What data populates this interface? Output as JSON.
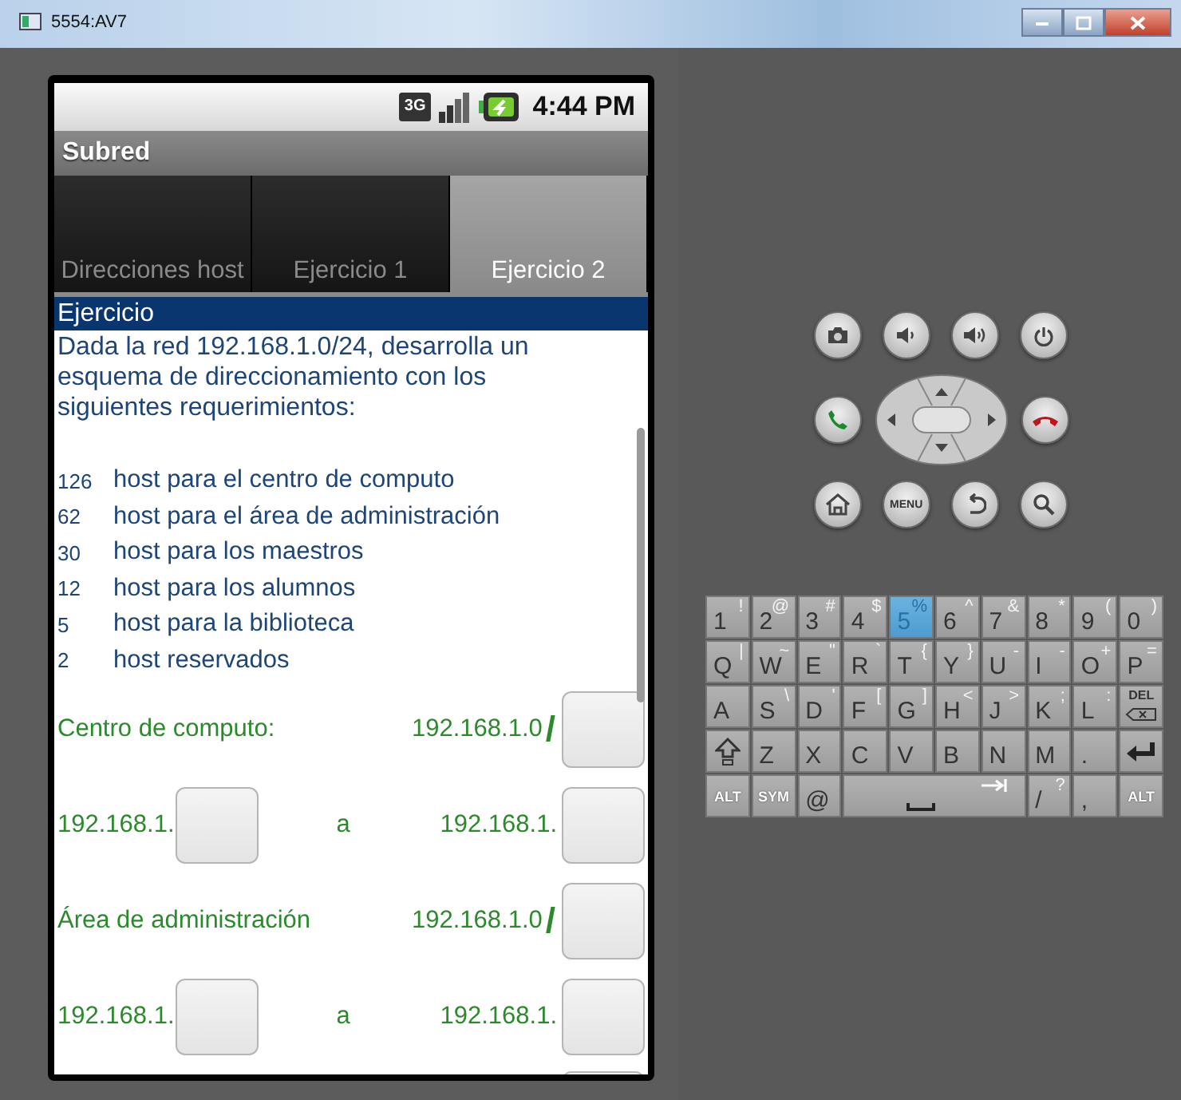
{
  "window": {
    "title": "5554:AV7"
  },
  "status_bar": {
    "network": "3G",
    "time": "4:44 PM"
  },
  "app_title": "Subred",
  "tabs": [
    {
      "label": "Direcciones host",
      "selected": false
    },
    {
      "label": "Ejercicio 1",
      "selected": false
    },
    {
      "label": "Ejercicio 2",
      "selected": true
    }
  ],
  "section_header": "Ejercicio",
  "intro": "Dada la red 192.168.1.0/24, desarrolla un esquema de direccionamiento con los siguientes requerimientos:",
  "requirements": [
    {
      "count": "126",
      "text": "host para el centro de computo"
    },
    {
      "count": "62",
      "text": "host para el área de administración"
    },
    {
      "count": "30",
      "text": "host para los maestros"
    },
    {
      "count": "12",
      "text": "host para los alumnos"
    },
    {
      "count": "5",
      "text": "host para la biblioteca"
    },
    {
      "count": "2",
      "text": "host reservados"
    }
  ],
  "form_rows": [
    {
      "kind": "network",
      "label": "Centro de computo:",
      "address": "192.168.1.0",
      "separator": "/"
    },
    {
      "kind": "range",
      "start_prefix": "192.168.1.",
      "connector": "a",
      "end_prefix": "192.168.1."
    },
    {
      "kind": "network",
      "label": "Área de administración",
      "address": "192.168.1.0",
      "separator": "/"
    },
    {
      "kind": "range",
      "start_prefix": "192.168.1.",
      "connector": "a",
      "end_prefix": "192.168.1."
    },
    {
      "kind": "partial"
    }
  ],
  "hardware_buttons": [
    [
      {
        "kind": "camera"
      },
      {
        "kind": "volume-down"
      },
      {
        "kind": "volume-up"
      },
      {
        "kind": "power"
      }
    ],
    [
      {
        "kind": "call"
      },
      {
        "kind": "dpad"
      },
      {
        "kind": "end-call"
      }
    ],
    [
      {
        "kind": "home"
      },
      {
        "kind": "menu",
        "label": "MENU"
      },
      {
        "kind": "back"
      },
      {
        "kind": "search"
      }
    ]
  ],
  "keyboard": [
    [
      {
        "kind": "char",
        "main": "1",
        "alt": "!",
        "pressed": false
      },
      {
        "kind": "char",
        "main": "2",
        "alt": "@",
        "pressed": false
      },
      {
        "kind": "char",
        "main": "3",
        "alt": "#",
        "pressed": false
      },
      {
        "kind": "char",
        "main": "4",
        "alt": "$",
        "pressed": false
      },
      {
        "kind": "char",
        "main": "5",
        "alt": "%",
        "pressed": true
      },
      {
        "kind": "char",
        "main": "6",
        "alt": "^",
        "pressed": false
      },
      {
        "kind": "char",
        "main": "7",
        "alt": "&",
        "pressed": false
      },
      {
        "kind": "char",
        "main": "8",
        "alt": "*",
        "pressed": false
      },
      {
        "kind": "char",
        "main": "9",
        "alt": "(",
        "pressed": false
      },
      {
        "kind": "char",
        "main": "0",
        "alt": ")",
        "pressed": false
      }
    ],
    [
      {
        "kind": "char",
        "main": "Q",
        "alt": "|",
        "pressed": false
      },
      {
        "kind": "char",
        "main": "W",
        "alt": "~",
        "pressed": false
      },
      {
        "kind": "char",
        "main": "E",
        "alt": "\"",
        "pressed": false
      },
      {
        "kind": "char",
        "main": "R",
        "alt": "`",
        "pressed": false
      },
      {
        "kind": "char",
        "main": "T",
        "alt": "{",
        "pressed": false
      },
      {
        "kind": "char",
        "main": "Y",
        "alt": "}",
        "pressed": false
      },
      {
        "kind": "char",
        "main": "U",
        "alt": "-",
        "pressed": false
      },
      {
        "kind": "char",
        "main": "I",
        "alt": "-",
        "pressed": false
      },
      {
        "kind": "char",
        "main": "O",
        "alt": "+",
        "pressed": false
      },
      {
        "kind": "char",
        "main": "P",
        "alt": "=",
        "pressed": false
      }
    ],
    [
      {
        "kind": "char",
        "main": "A",
        "pressed": false
      },
      {
        "kind": "char",
        "main": "S",
        "alt": "\\",
        "pressed": false
      },
      {
        "kind": "char",
        "main": "D",
        "alt": "'",
        "pressed": false
      },
      {
        "kind": "char",
        "main": "F",
        "alt": "[",
        "pressed": false
      },
      {
        "kind": "char",
        "main": "G",
        "alt": "]",
        "pressed": false
      },
      {
        "kind": "char",
        "main": "H",
        "alt": "<",
        "pressed": false
      },
      {
        "kind": "char",
        "main": "J",
        "alt": ">",
        "pressed": false
      },
      {
        "kind": "char",
        "main": "K",
        "alt": ";",
        "pressed": false
      },
      {
        "kind": "char",
        "main": "L",
        "alt": ":",
        "pressed": false
      },
      {
        "kind": "delete",
        "main": "DEL",
        "pressed": false
      }
    ],
    [
      {
        "kind": "shift",
        "pressed": false
      },
      {
        "kind": "char",
        "main": "Z",
        "pressed": false
      },
      {
        "kind": "char",
        "main": "X",
        "pressed": false
      },
      {
        "kind": "char",
        "main": "C",
        "pressed": false
      },
      {
        "kind": "char",
        "main": "V",
        "pressed": false
      },
      {
        "kind": "char",
        "main": "B",
        "pressed": false
      },
      {
        "kind": "char",
        "main": "N",
        "pressed": false
      },
      {
        "kind": "char",
        "main": "M",
        "pressed": false
      },
      {
        "kind": "char",
        "main": ".",
        "pressed": false
      },
      {
        "kind": "enter",
        "pressed": false
      }
    ],
    [
      {
        "kind": "label",
        "main": "ALT",
        "pressed": false
      },
      {
        "kind": "label",
        "main": "SYM",
        "pressed": false
      },
      {
        "kind": "char",
        "main": "@",
        "pressed": false
      },
      {
        "kind": "space",
        "pressed": false
      },
      {
        "kind": "char",
        "main": "/",
        "alt": "?",
        "pressed": false
      },
      {
        "kind": "char",
        "main": ",",
        "pressed": false
      },
      {
        "kind": "label",
        "main": "ALT",
        "pressed": false
      }
    ]
  ]
}
